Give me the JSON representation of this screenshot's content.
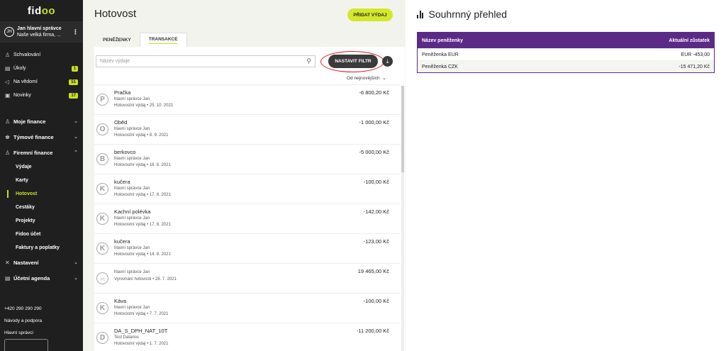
{
  "app": {
    "logo_prefix": "fid",
    "logo_suffix": "oo"
  },
  "user": {
    "initials": "JH",
    "name": "Jan hlavní správce",
    "company": "Naše velká firma, ..."
  },
  "nav_top": [
    {
      "label": "Schvalování",
      "icon": "approval-icon",
      "badge": ""
    },
    {
      "label": "Úkoly",
      "icon": "tasks-icon",
      "badge": "1"
    },
    {
      "label": "Na vědomí",
      "icon": "notice-icon",
      "badge": "51"
    },
    {
      "label": "Novinky",
      "icon": "news-icon",
      "badge": "17"
    }
  ],
  "nav_groups": {
    "my_finance": "Moje finance",
    "team_finance": "Týmové finance",
    "company_finance": "Firemní finance",
    "company_sub": [
      "Výdaje",
      "Karty",
      "Hotovost",
      "Cestáky",
      "Projekty",
      "Fidoo účet",
      "Faktury a poplatky"
    ],
    "settings": "Nastavení",
    "accounting": "Účetní agenda"
  },
  "footer": {
    "phone": "+420 290 290 290",
    "guides": "Návody a podpora",
    "admin": "Hlavní správci"
  },
  "main": {
    "title": "Hotovost",
    "add_button": "PŘIDAT VÝDAJ",
    "tabs": [
      "PENĚŽENKY",
      "TRANSAKCE"
    ],
    "search_placeholder": "Název výdaje",
    "filter_button": "NASTAVIT FILTR",
    "sort_label": "Od nejnovějších"
  },
  "transactions": [
    {
      "letter": "P",
      "name": "Pračka",
      "user": "hlavní správce Jan",
      "meta": "Hotovostní výdaj • 25. 10. 2021",
      "amount": "-6 800,20 Kč"
    },
    {
      "letter": "O",
      "name": "Oběd",
      "user": "hlavní správce Jan",
      "meta": "Hotovostní výdaj • 8. 9. 2021",
      "amount": "-1 000,00 Kč"
    },
    {
      "letter": "B",
      "name": "berkovco",
      "user": "hlavní správce Jan",
      "meta": "Hotovostní výdaj • 18. 8. 2021",
      "amount": "-5 000,00 Kč"
    },
    {
      "letter": "K",
      "name": "kučera",
      "user": "hlavní správce Jan",
      "meta": "Hotovostní výdaj • 17. 8. 2021",
      "amount": "-100,00 Kč"
    },
    {
      "letter": "K",
      "name": "Kachní polévka",
      "user": "hlavní správce Jan",
      "meta": "Hotovostní výdaj • 17. 8. 2021",
      "amount": "-142,00 Kč"
    },
    {
      "letter": "K",
      "name": "kučera",
      "user": "hlavní správce Jan",
      "meta": "Hotovostní výdaj • 14. 8. 2021",
      "amount": "-123,00 Kč"
    },
    {
      "letter": "",
      "name": "",
      "user": "hlavní správce Jan",
      "meta": "Vyrovnání hotovosti • 28. 7. 2021",
      "amount": "19 465,00 Kč"
    },
    {
      "letter": "K",
      "name": "Káva",
      "user": "hlavní správce Jan",
      "meta": "Hotovostní výdaj • 7. 7. 2021",
      "amount": "-100,00 Kč"
    },
    {
      "letter": "D",
      "name": "DA_S_DPH_NAT_10T",
      "user": "Test Datarios",
      "meta": "Hotovostní výdaj • 1. 7. 2021",
      "amount": "-11 200,00 Kč"
    }
  ],
  "summary": {
    "title": "Souhrnný přehled",
    "col_name": "Název peněženky",
    "col_balance": "Aktuální zůstatek",
    "rows": [
      {
        "name": "Peněženka EUR",
        "balance": "EUR -453,00"
      },
      {
        "name": "Peněženka CZK",
        "balance": "-15 471,20 Kč"
      }
    ]
  },
  "colors": {
    "accent": "#c8e01e",
    "sidebar": "#1f1f1f",
    "table_head": "#5b2a86",
    "highlight_ring": "#e21b1b"
  }
}
